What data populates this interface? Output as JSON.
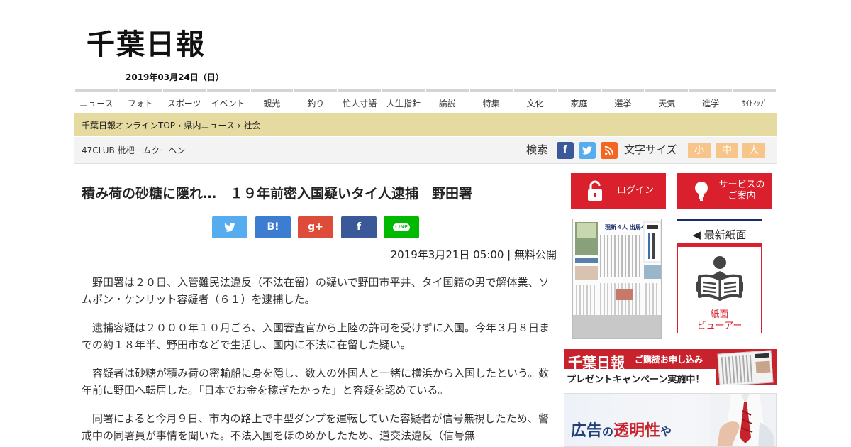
{
  "site": {
    "logo": "千葉日報",
    "date": "2019年03月24日（日）"
  },
  "nav": {
    "items": [
      "ニュース",
      "フォト",
      "スポーツ",
      "イベント",
      "観光",
      "釣り",
      "忙人寸語",
      "人生指針",
      "論説",
      "特集",
      "文化",
      "家庭",
      "選挙",
      "天気",
      "進学",
      "ｻｲﾄﾏｯﾌﾟ"
    ]
  },
  "breadcrumb": {
    "items": [
      "千葉日報オンラインTOP",
      "県内ニュース",
      "社会"
    ],
    "separator": "›"
  },
  "subbar": {
    "promo": "47CLUB 枇杷ームクーヘン",
    "search_label": "検索",
    "font_size_label": "文字サイズ",
    "font_sizes": [
      "小",
      "中",
      "大"
    ]
  },
  "article": {
    "headline": "積み荷の砂糖に隠れ…　１９年前密入国疑いタイ人逮捕　野田署",
    "pubinfo": "2019年3月21日 05:00 | 無料公開",
    "paragraphs": [
      "　野田署は２０日、入管難民法違反（不法在留）の疑いで野田市平井、タイ国籍の男で解体業、ソムポン・ケンリット容疑者（６１）を逮捕した。",
      "　逮捕容疑は２０００年１０月ごろ、入国審査官から上陸の許可を受けずに入国。今年３月８日までの約１８年半、野田市などで生活し、国内に不法に在留した疑い。",
      "　容疑者は砂糖が積み荷の密輸船に身を隠し、数人の外国人と一緒に横浜から入国したという。数年前に野田へ転居した。「日本でお金を稼ぎたかった」と容疑を認めている。",
      "　同署によると今月９日、市内の路上で中型ダンプを運転していた容疑者が信号無視したため、警戒中の同署員が事情を聞いた。不法入国をほのめかしたため、道交法違反（信号無"
    ]
  },
  "share": {
    "line_label": "LINE",
    "hatena_label": "B!",
    "gplus_label": "g+"
  },
  "sidebar": {
    "login_label": "ログイン",
    "service_label": "サービスの\nご案内",
    "latest_title": "◀ 最新紙面",
    "viewer_label": "紙面\nビューアー",
    "thumb_headline": "現新４人 出馬へ",
    "banner1_logo": "千葉日報",
    "banner1_sub": "ご購読お申し込み",
    "banner1_text": "プレゼントキャンペーン実施中！",
    "banner2_text_a": "広告",
    "banner2_text_b": "の",
    "banner2_text_c": "透明性",
    "banner2_text_d": "や"
  },
  "colors": {
    "accent_red": "#d9202c",
    "breadcrumb_bg": "#e5dba0",
    "facebook": "#3b5998",
    "twitter": "#55acee",
    "rss": "#f26522",
    "hatena": "#3c7dd1",
    "gplus": "#dd4b39",
    "line": "#00b900",
    "font_size_btn": "#f7c58a",
    "navy": "#1a2a6c"
  }
}
